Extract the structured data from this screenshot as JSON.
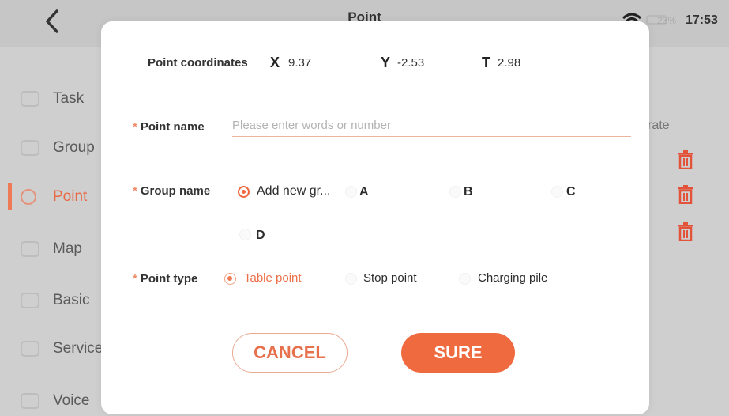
{
  "header": {
    "title": "Point",
    "battery": "23%",
    "time": "17:53",
    "colors": {
      "accent": "#ef6a3f",
      "background": "#cfcfcf"
    }
  },
  "sidebar": {
    "items": [
      {
        "label": "Task",
        "icon": "task-icon"
      },
      {
        "label": "Group",
        "icon": "group-icon"
      },
      {
        "label": "Point",
        "icon": "point-icon",
        "active": true
      },
      {
        "label": "Map",
        "icon": "map-icon"
      },
      {
        "label": "Basic",
        "icon": "basic-icon"
      },
      {
        "label": "Service",
        "icon": "service-icon"
      },
      {
        "label": "Voice",
        "icon": "voice-icon"
      }
    ]
  },
  "background": {
    "operate_label": "rate"
  },
  "dialog": {
    "coords": {
      "label": "Point coordinates",
      "x_label": "X",
      "x_value": "9.37",
      "y_label": "Y",
      "y_value": "-2.53",
      "t_label": "T",
      "t_value": "2.98"
    },
    "point_name": {
      "required_mark": "*",
      "label": "Point name",
      "value": "",
      "placeholder": "Please enter words or number"
    },
    "group_name": {
      "required_mark": "*",
      "label": "Group name",
      "options": [
        {
          "label": "Add new gr...",
          "selected": true
        },
        {
          "label": "A",
          "selected": false
        },
        {
          "label": "B",
          "selected": false
        },
        {
          "label": "C",
          "selected": false
        },
        {
          "label": "D",
          "selected": false
        }
      ]
    },
    "point_type": {
      "required_mark": "*",
      "label": "Point type",
      "options": [
        {
          "label": "Table point",
          "selected": true
        },
        {
          "label": "Stop point",
          "selected": false
        },
        {
          "label": "Charging pile",
          "selected": false
        }
      ]
    },
    "cancel_label": "CANCEL",
    "sure_label": "SURE"
  }
}
